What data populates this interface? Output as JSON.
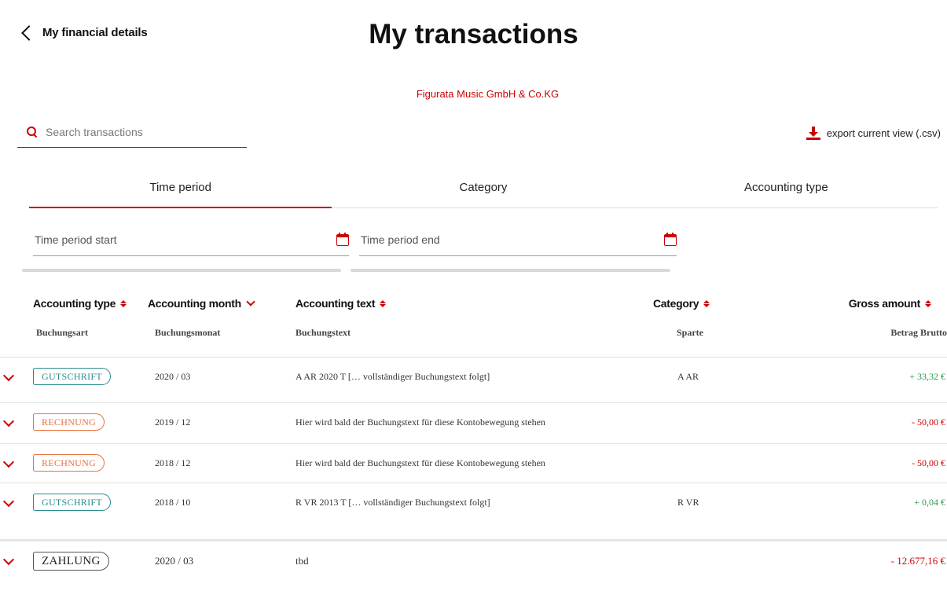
{
  "header": {
    "back_label": "My financial details",
    "title": "My transactions",
    "company": "Figurata Music GmbH & Co.KG"
  },
  "search": {
    "placeholder": "Search transactions"
  },
  "export": {
    "label": "export current view (.csv)"
  },
  "filters": {
    "tabs": [
      {
        "label": "Time period",
        "active": true
      },
      {
        "label": "Category",
        "active": false
      },
      {
        "label": "Accounting type",
        "active": false
      }
    ],
    "start_placeholder": "Time period start",
    "end_placeholder": "Time period end"
  },
  "table": {
    "columns": [
      {
        "en": "Accounting type",
        "de": "Buchungsart"
      },
      {
        "en": "Accounting month",
        "de": "Buchungsmonat"
      },
      {
        "en": "Accounting text",
        "de": "Buchungstext"
      },
      {
        "en": "Category",
        "de": "Sparte"
      },
      {
        "en": "Gross amount",
        "de": "Betrag Brutto"
      }
    ],
    "rows": [
      {
        "type": "GUTSCHRIFT",
        "month": "2020 / 03",
        "text": "A AR 2020 T [… vollständiger Buchungstext folgt]",
        "category": "A AR",
        "amount": "+ 33,32 €"
      },
      {
        "type": "RECHNUNG",
        "month": "2019 / 12",
        "text": "Hier wird bald der Buchungstext für diese Kontobewegung stehen",
        "category": "",
        "amount": "- 50,00 €"
      },
      {
        "type": "RECHNUNG",
        "month": "2018 / 12",
        "text": "Hier wird bald der Buchungstext für diese Kontobewegung stehen",
        "category": "",
        "amount": "- 50,00 €"
      },
      {
        "type": "GUTSCHRIFT",
        "month": "2018 / 10",
        "text": "R VR 2013 T [… vollständiger Buchungstext folgt]",
        "category": "R VR",
        "amount": "+ 0,04 €"
      },
      {
        "type": "ZAHLUNG",
        "month": "2020 / 03",
        "text": "tbd",
        "category": "",
        "amount": "- 12.677,16 €"
      }
    ]
  },
  "colors": {
    "accent": "#cc0000",
    "positive": "#2a9a4a",
    "gutschrift": "#2a8c8c",
    "rechnung": "#e8703a"
  },
  "icons": [
    "back-chevron-icon",
    "search-icon",
    "download-icon",
    "calendar-icon",
    "sort-icon",
    "expand-chevron-icon"
  ]
}
